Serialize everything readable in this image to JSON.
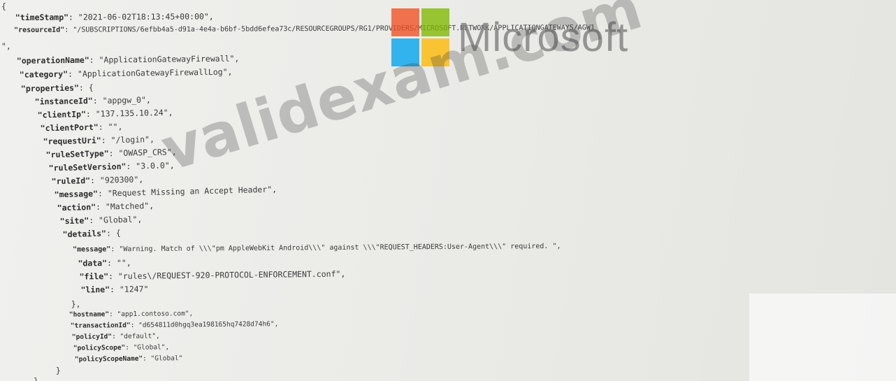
{
  "logo": {
    "word": "Microsoft",
    "colors": {
      "red": "#f25022",
      "green": "#7fba00",
      "blue": "#00a4ef",
      "yellow": "#ffb900"
    }
  },
  "watermark": "validexam.com",
  "json_lines": [
    {
      "indent": "",
      "key": "",
      "value": "{",
      "tail": ""
    },
    {
      "indent": "  ",
      "key": "timeStamp",
      "value": "\"2021-06-02T18:13:45+00:00\"",
      "tail": ","
    },
    {
      "indent": "  ",
      "key": "resourceId",
      "value": "\"/SUBSCRIPTIONS/6efbb4a5-d91a-4e4a-b6bf-5bdd6efea73c/RESOURCEGROUPS/RG1/PROVIDERS/MICROSOFT.NETWORK/APPLICATIONGATEWAYS/AGW1",
      "tail": ""
    },
    {
      "indent": "",
      "key": "",
      "value": "\",",
      "tail": ""
    },
    {
      "indent": "  ",
      "key": "operationName",
      "value": "\"ApplicationGatewayFirewall\"",
      "tail": ","
    },
    {
      "indent": "  ",
      "key": "category",
      "value": "\"ApplicationGatewayFirewallLog\"",
      "tail": ","
    },
    {
      "indent": "  ",
      "key": "properties",
      "value": "{",
      "tail": ""
    },
    {
      "indent": "    ",
      "key": "instanceId",
      "value": "\"appgw_0\"",
      "tail": ","
    },
    {
      "indent": "    ",
      "key": "clientIp",
      "value": "\"137.135.10.24\"",
      "tail": ","
    },
    {
      "indent": "    ",
      "key": "clientPort",
      "value": "\"\"",
      "tail": ","
    },
    {
      "indent": "    ",
      "key": "requestUri",
      "value": "\"/login\"",
      "tail": ","
    },
    {
      "indent": "    ",
      "key": "ruleSetType",
      "value": "\"OWASP_CRS\"",
      "tail": ","
    },
    {
      "indent": "    ",
      "key": "ruleSetVersion",
      "value": "\"3.0.0\"",
      "tail": ","
    },
    {
      "indent": "    ",
      "key": "ruleId",
      "value": "\"920300\"",
      "tail": ","
    },
    {
      "indent": "    ",
      "key": "message",
      "value": "\"Request Missing an Accept Header\"",
      "tail": ","
    },
    {
      "indent": "    ",
      "key": "action",
      "value": "\"Matched\"",
      "tail": ","
    },
    {
      "indent": "    ",
      "key": "site",
      "value": "\"Global\"",
      "tail": ","
    },
    {
      "indent": "    ",
      "key": "details",
      "value": "{",
      "tail": ""
    },
    {
      "indent": "      ",
      "key": "message",
      "value": "\"Warning. Match of \\\\\\\"pm AppleWebKit Android\\\\\\\" against \\\\\\\"REQUEST_HEADERS:User-Agent\\\\\\\" required. \"",
      "tail": ","
    },
    {
      "indent": "      ",
      "key": "data",
      "value": "\"\"",
      "tail": ","
    },
    {
      "indent": "      ",
      "key": "file",
      "value": "\"rules\\/REQUEST-920-PROTOCOL-ENFORCEMENT.conf\"",
      "tail": ","
    },
    {
      "indent": "      ",
      "key": "line",
      "value": "\"1247\"",
      "tail": ""
    },
    {
      "indent": "    ",
      "key": "",
      "value": "},",
      "tail": ""
    },
    {
      "indent": "    ",
      "key": "hostname",
      "value": "\"app1.contoso.com\"",
      "tail": ","
    },
    {
      "indent": "    ",
      "key": "transactionId",
      "value": "\"d654811d0hgq3ea198165hq7428d74h6\"",
      "tail": ","
    },
    {
      "indent": "    ",
      "key": "policyId",
      "value": "\"default\"",
      "tail": ","
    },
    {
      "indent": "    ",
      "key": "policyScope",
      "value": "\"Global\"",
      "tail": ","
    },
    {
      "indent": "    ",
      "key": "policyScopeName",
      "value": "\"Global\"",
      "tail": ""
    },
    {
      "indent": "  ",
      "key": "",
      "value": "}",
      "tail": ""
    },
    {
      "indent": "",
      "key": "",
      "value": "}",
      "tail": ""
    }
  ]
}
